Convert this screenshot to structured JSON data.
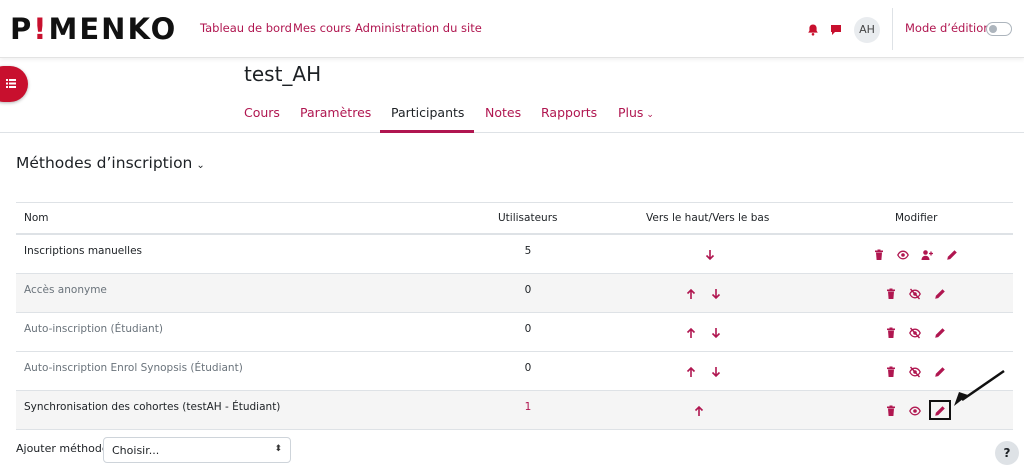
{
  "brand": {
    "logo_pre": "P",
    "logo_bang": "!",
    "logo_post": "MENKO"
  },
  "topnav": {
    "links": [
      "Tableau de bord",
      "Mes cours",
      "Administration du site"
    ],
    "avatar_initials": "AH",
    "edit_mode_label": "Mode d’édition"
  },
  "course": {
    "title": "test_AH",
    "tabs": [
      "Cours",
      "Paramètres",
      "Participants",
      "Notes",
      "Rapports",
      "Plus"
    ],
    "active_tab": "Participants"
  },
  "section": {
    "title": "Méthodes d’inscription",
    "chevron": "⌄"
  },
  "table": {
    "headers": [
      "Nom",
      "Utilisateurs",
      "Vers le haut/Vers le bas",
      "Modifier"
    ],
    "rows": [
      {
        "name": "Inscriptions manuelles",
        "users": "5",
        "enabled": true,
        "move": [
          "down"
        ],
        "actions": [
          "delete",
          "eye",
          "enrol-users",
          "edit"
        ]
      },
      {
        "name": "Accès anonyme",
        "users": "0",
        "enabled": false,
        "move": [
          "up",
          "down"
        ],
        "actions": [
          "delete",
          "eye-slash",
          "edit"
        ]
      },
      {
        "name": "Auto-inscription (Étudiant)",
        "users": "0",
        "enabled": false,
        "move": [
          "up",
          "down"
        ],
        "actions": [
          "delete",
          "eye-slash",
          "edit"
        ]
      },
      {
        "name": "Auto-inscription Enrol Synopsis (Étudiant)",
        "users": "0",
        "enabled": false,
        "move": [
          "up",
          "down"
        ],
        "actions": [
          "delete",
          "eye-slash",
          "edit"
        ]
      },
      {
        "name": "Synchronisation des cohortes (testAH - Étudiant)",
        "users": "1",
        "enabled": true,
        "users_link": true,
        "move": [
          "up"
        ],
        "actions": [
          "delete",
          "eye",
          "edit"
        ]
      }
    ]
  },
  "add_method": {
    "label": "Ajouter méthode",
    "selected": "Choisir..."
  },
  "help": {
    "label": "?"
  },
  "colors": {
    "accent": "#b01650",
    "brand_red": "#c8102e"
  }
}
